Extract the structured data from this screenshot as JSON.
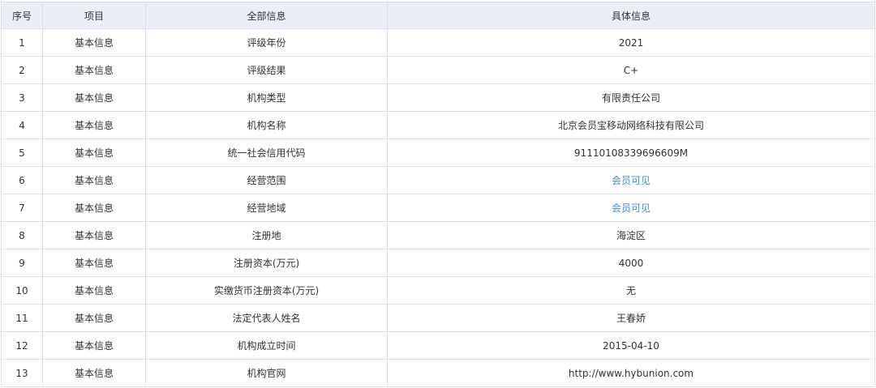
{
  "table": {
    "columns": [
      "序号",
      "项目",
      "全部信息",
      "具体信息"
    ],
    "rows": [
      {
        "index": "1",
        "category": "基本信息",
        "field": "评级年份",
        "value": "2021",
        "link": false
      },
      {
        "index": "2",
        "category": "基本信息",
        "field": "评级结果",
        "value": "C+",
        "link": false
      },
      {
        "index": "3",
        "category": "基本信息",
        "field": "机构类型",
        "value": "有限责任公司",
        "link": false
      },
      {
        "index": "4",
        "category": "基本信息",
        "field": "机构名称",
        "value": "北京会员宝移动网络科技有限公司",
        "link": false
      },
      {
        "index": "5",
        "category": "基本信息",
        "field": "统一社会信用代码",
        "value": "91110108339696609M",
        "link": false
      },
      {
        "index": "6",
        "category": "基本信息",
        "field": "经营范围",
        "value": "会员可见",
        "link": true
      },
      {
        "index": "7",
        "category": "基本信息",
        "field": "经营地域",
        "value": "会员可见",
        "link": true
      },
      {
        "index": "8",
        "category": "基本信息",
        "field": "注册地",
        "value": "海淀区",
        "link": false
      },
      {
        "index": "9",
        "category": "基本信息",
        "field": "注册资本(万元)",
        "value": "4000",
        "link": false
      },
      {
        "index": "10",
        "category": "基本信息",
        "field": "实缴货币注册资本(万元)",
        "value": "无",
        "link": false
      },
      {
        "index": "11",
        "category": "基本信息",
        "field": "法定代表人姓名",
        "value": "王春娇",
        "link": false
      },
      {
        "index": "12",
        "category": "基本信息",
        "field": "机构成立时间",
        "value": "2015-04-10",
        "link": false
      },
      {
        "index": "13",
        "category": "基本信息",
        "field": "机构官网",
        "value": "http://www.hybunion.com",
        "link": false
      }
    ]
  },
  "colors": {
    "header_bg": "#e9eef7",
    "border": "#d9dee8",
    "text": "#333333",
    "link": "#3d8ee6"
  }
}
